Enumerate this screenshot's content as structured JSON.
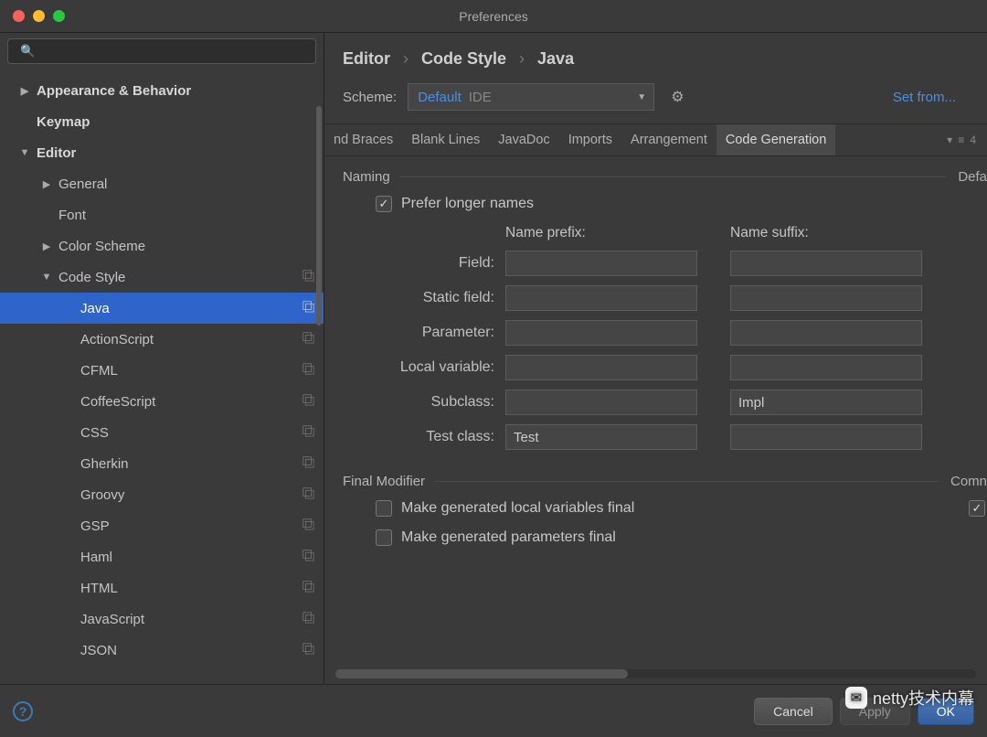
{
  "window": {
    "title": "Preferences"
  },
  "search": {
    "placeholder": ""
  },
  "sidebar": {
    "items": [
      {
        "label": "Appearance & Behavior",
        "level": 0,
        "arrow": "▶",
        "bold": true
      },
      {
        "label": "Keymap",
        "level": 0,
        "arrow": "",
        "bold": true
      },
      {
        "label": "Editor",
        "level": 0,
        "arrow": "▼",
        "bold": true
      },
      {
        "label": "General",
        "level": 1,
        "arrow": "▶"
      },
      {
        "label": "Font",
        "level": 1,
        "arrow": ""
      },
      {
        "label": "Color Scheme",
        "level": 1,
        "arrow": "▶"
      },
      {
        "label": "Code Style",
        "level": 1,
        "arrow": "▼",
        "icon": true
      },
      {
        "label": "Java",
        "level": 2,
        "arrow": "",
        "selected": true,
        "icon": true
      },
      {
        "label": "ActionScript",
        "level": 2,
        "arrow": "",
        "icon": true
      },
      {
        "label": "CFML",
        "level": 2,
        "arrow": "",
        "icon": true
      },
      {
        "label": "CoffeeScript",
        "level": 2,
        "arrow": "",
        "icon": true
      },
      {
        "label": "CSS",
        "level": 2,
        "arrow": "",
        "icon": true
      },
      {
        "label": "Gherkin",
        "level": 2,
        "arrow": "",
        "icon": true
      },
      {
        "label": "Groovy",
        "level": 2,
        "arrow": "",
        "icon": true
      },
      {
        "label": "GSP",
        "level": 2,
        "arrow": "",
        "icon": true
      },
      {
        "label": "Haml",
        "level": 2,
        "arrow": "",
        "icon": true
      },
      {
        "label": "HTML",
        "level": 2,
        "arrow": "",
        "icon": true
      },
      {
        "label": "JavaScript",
        "level": 2,
        "arrow": "",
        "icon": true
      },
      {
        "label": "JSON",
        "level": 2,
        "arrow": "",
        "icon": true
      }
    ]
  },
  "breadcrumb": {
    "a": "Editor",
    "b": "Code Style",
    "c": "Java"
  },
  "scheme": {
    "label": "Scheme:",
    "value": "Default",
    "badge": "IDE",
    "setfrom": "Set from..."
  },
  "tabs": {
    "items": [
      {
        "label": "nd Braces"
      },
      {
        "label": "Blank Lines"
      },
      {
        "label": "JavaDoc"
      },
      {
        "label": "Imports"
      },
      {
        "label": "Arrangement"
      },
      {
        "label": "Code Generation",
        "active": true
      }
    ],
    "indicator": "4"
  },
  "naming": {
    "title": "Naming",
    "right_cut": "Defa",
    "prefer_longer": "Prefer longer names",
    "col_prefix": "Name prefix:",
    "col_suffix": "Name suffix:",
    "rows": [
      {
        "label": "Field:",
        "prefix": "",
        "suffix": ""
      },
      {
        "label": "Static field:",
        "prefix": "",
        "suffix": ""
      },
      {
        "label": "Parameter:",
        "prefix": "",
        "suffix": ""
      },
      {
        "label": "Local variable:",
        "prefix": "",
        "suffix": ""
      },
      {
        "label": "Subclass:",
        "prefix": "",
        "suffix": "Impl"
      },
      {
        "label": "Test class:",
        "prefix": "Test",
        "suffix": ""
      }
    ]
  },
  "final": {
    "title": "Final Modifier",
    "right_cut": "Comn",
    "opt1": "Make generated local variables final",
    "opt2": "Make generated parameters final"
  },
  "footer": {
    "cancel": "Cancel",
    "apply": "Apply",
    "ok": "OK"
  },
  "watermark": "netty技术内幕"
}
